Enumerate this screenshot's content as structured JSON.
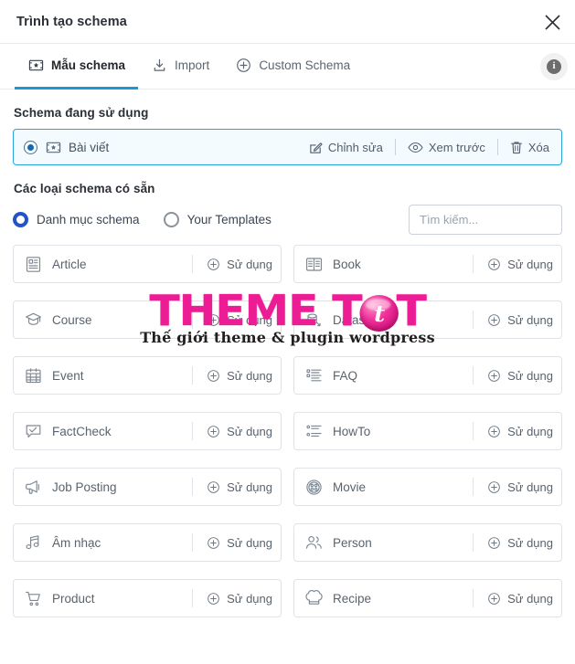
{
  "header": {
    "title": "Trình tạo schema",
    "close_icon": "close-icon"
  },
  "tabs": [
    {
      "label": "Mẫu schema",
      "icon": "schema-template-icon",
      "active": true
    },
    {
      "label": "Import",
      "icon": "import-download-icon",
      "active": false
    },
    {
      "label": "Custom Schema",
      "icon": "plus-circle-icon",
      "active": false
    }
  ],
  "info_button": {
    "icon": "info-icon",
    "glyph": "i"
  },
  "active_section": {
    "title": "Schema đang sử dụng",
    "item": {
      "name": "Bài viết",
      "selected": true,
      "icon": "schema-template-icon",
      "actions": [
        {
          "label": "Chỉnh sửa",
          "icon": "edit-pencil-icon"
        },
        {
          "label": "Xem trước",
          "icon": "eye-icon"
        },
        {
          "label": "Xóa",
          "icon": "trash-icon"
        }
      ]
    }
  },
  "catalog": {
    "title": "Các loại schema có sẵn",
    "filters": [
      {
        "label": "Danh mục schema",
        "selected": true
      },
      {
        "label": "Your Templates",
        "selected": false
      }
    ],
    "search": {
      "value": "",
      "placeholder": "Tìm kiếm..."
    },
    "use_label": "Sử dụng",
    "items": [
      {
        "name": "Article",
        "icon": "article-icon"
      },
      {
        "name": "Book",
        "icon": "book-icon"
      },
      {
        "name": "Course",
        "icon": "graduation-cap-icon"
      },
      {
        "name": "Dataset",
        "icon": "dataset-icon"
      },
      {
        "name": "Event",
        "icon": "calendar-icon"
      },
      {
        "name": "FAQ",
        "icon": "list-icon"
      },
      {
        "name": "FactCheck",
        "icon": "check-bubble-icon"
      },
      {
        "name": "HowTo",
        "icon": "numbered-list-icon"
      },
      {
        "name": "Job Posting",
        "icon": "megaphone-icon"
      },
      {
        "name": "Movie",
        "icon": "film-reel-icon"
      },
      {
        "name": "Âm nhạc",
        "icon": "music-note-icon"
      },
      {
        "name": "Person",
        "icon": "people-icon"
      },
      {
        "name": "Product",
        "icon": "shopping-cart-icon"
      },
      {
        "name": "Recipe",
        "icon": "chef-hat-icon"
      }
    ]
  },
  "watermark": {
    "text_1": "THEME T",
    "badge_letter": "t",
    "text_2": "T",
    "subtitle": "Thế giới theme & plugin wordpress",
    "color": "#ec1c94"
  },
  "colors": {
    "accent_blue": "#1a97d4",
    "radio_blue": "#2352ce",
    "active_border": "#2aa4dd",
    "active_bg": "#f4fbfe",
    "tile_border": "#dfe3e7",
    "watermark_pink": "#ec1c94"
  }
}
